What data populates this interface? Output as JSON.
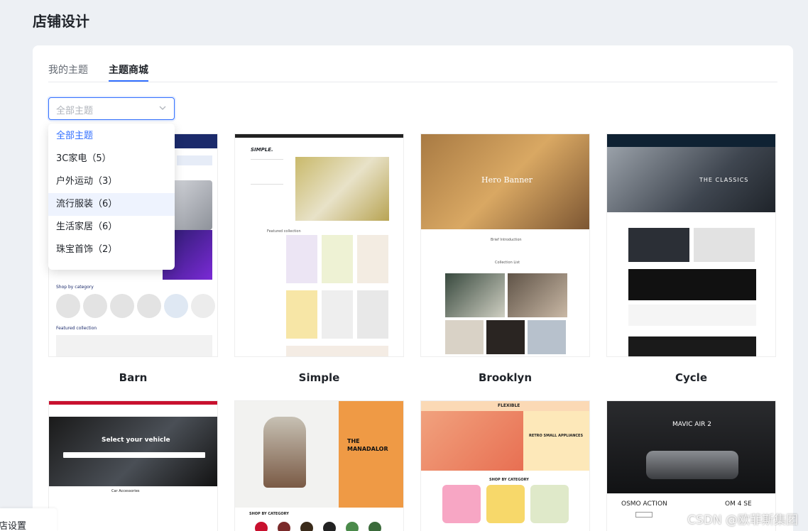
{
  "page_title": "店铺设计",
  "tabs": [
    {
      "label": "我的主题"
    },
    {
      "label": "主题商城"
    }
  ],
  "filter": {
    "placeholder": "全部主题",
    "options": [
      {
        "label": "全部主题"
      },
      {
        "label": "3C家电（5）"
      },
      {
        "label": "户外运动（3）"
      },
      {
        "label": "流行服装（6）"
      },
      {
        "label": "生活家居（6）"
      },
      {
        "label": "珠宝首饰（2）"
      }
    ]
  },
  "themes": [
    {
      "name": "Barn"
    },
    {
      "name": "Simple"
    },
    {
      "name": "Brooklyn"
    },
    {
      "name": "Cycle"
    },
    {
      "name": ""
    },
    {
      "name": ""
    },
    {
      "name": ""
    },
    {
      "name": ""
    }
  ],
  "previews": {
    "barn": {
      "section1": "Shop by category",
      "section2": "Featured collection"
    },
    "simple": {
      "logo": "SIMPLE.",
      "section": "Featured collection"
    },
    "brooklyn": {
      "hero": "Hero Banner",
      "intro": "Brief Introduction",
      "list": "Collection List"
    },
    "cycle": {
      "hero": "THE CLASSICS"
    },
    "auto": {
      "hero": "Select your vehicle",
      "section": "Car Accessories"
    },
    "manadalor": {
      "hero_line1": "THE",
      "hero_line2": "MANADALOR",
      "section": "SHOP BY CATEGORY"
    },
    "flexible": {
      "brand": "FLEXIBLE",
      "hero": "RETRO SMALL APPLIANCES",
      "section": "SHOP BY CATEGORY"
    },
    "drone": {
      "hero": "MAVIC AIR 2",
      "item1": "OSMO ACTION",
      "item2": "OM 4 SE"
    }
  },
  "bottom_label": "店设置",
  "watermark": "CSDN @欧菲斯集团",
  "colors": {
    "accent": "#3370ff",
    "selected_bg": "#eef3fe"
  }
}
